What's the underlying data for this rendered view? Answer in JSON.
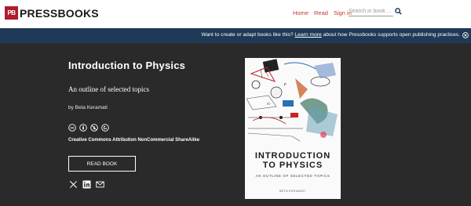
{
  "header": {
    "logo_mark": "PB",
    "logo_text": "PRESSBOOKS",
    "nav": [
      {
        "label": "Home"
      },
      {
        "label": "Read"
      },
      {
        "label": "Sign in"
      }
    ],
    "search_placeholder": "Search in book ...",
    "accent_color": "#c0392b"
  },
  "banner": {
    "text_before": "Want to create or adapt books like this?",
    "link": "Learn more",
    "text_after": "about how Pressbooks supports open publishing practices.",
    "background": "#1e3a56"
  },
  "book": {
    "title": "Introduction to Physics",
    "subtitle": "An outline of selected topics",
    "author": "by Beta Keramati",
    "license_icons": [
      "cc-icon",
      "attribution-icon",
      "noncommercial-icon",
      "sharealike-icon"
    ],
    "license": "Creative Commons Attribution NonCommercial ShareAlike",
    "read_button": "READ BOOK",
    "share_icons": [
      "twitter-x-icon",
      "linkedin-icon",
      "email-icon"
    ]
  },
  "cover": {
    "title_line1": "INTRODUCTION",
    "title_line2": "TO PHYSICS",
    "subtitle": "AN OUTLINE OF SELECTED TOPICS",
    "author": "BETA KERAMATI"
  }
}
